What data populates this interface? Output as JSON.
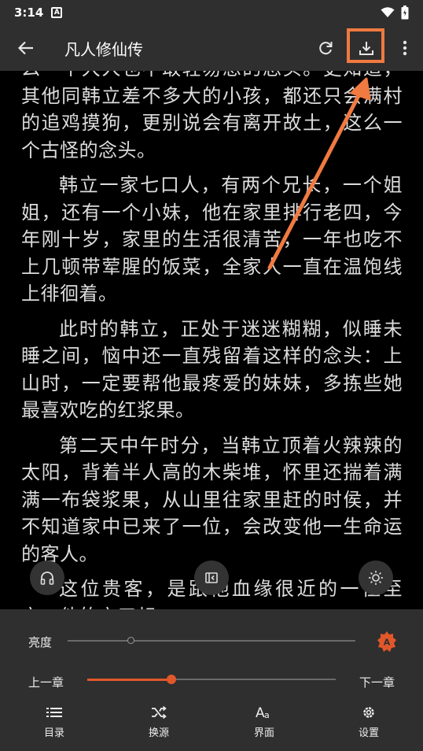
{
  "status_bar": {
    "time": "3:14",
    "notif_letter": "A"
  },
  "toolbar": {
    "title": "凡人修仙传"
  },
  "content": {
    "paragraphs": [
      "么一个大人也不敢轻易想的念头。更知道，其他同韩立差不多大的小孩，都还只会满村的追鸡摸狗，更别说会有离开故土，这么一个古怪的念头。",
      "韩立一家七口人，有两个兄长，一个姐姐，还有一个小妹，他在家里排行老四，今年刚十岁，家里的生活很清苦，一年也吃不上几顿带荤腥的饭菜，全家人一直在温饱线上徘徊着。",
      "此时的韩立，正处于迷迷糊糊，似睡未睡之间，恼中还一直残留着这样的念头：上山时，一定要帮他最疼爱的妹妹，多拣些她最喜欢吃的红浆果。",
      "第二天中午时分，当韩立顶着火辣辣的太阳，背着半人高的木柴堆，怀里还揣着满满一布袋浆果，从山里往家里赶的时侯，并不知道家中已来了一位，会改变他一生命运的客人。",
      "这位贵客，是跟他血缘很近的一位至亲，他的亲三叔。"
    ]
  },
  "brightness": {
    "label": "亮度",
    "level": 0.22,
    "auto_badge": "A"
  },
  "chapter": {
    "prev_label": "上一章",
    "next_label": "下一章",
    "progress": 0.34
  },
  "menu": {
    "items": [
      {
        "label": "目录",
        "icon": "list-icon"
      },
      {
        "label": "换源",
        "icon": "shuffle-icon"
      },
      {
        "label": "界面",
        "icon": "font-icon"
      },
      {
        "label": "设置",
        "icon": "gear-icon"
      }
    ]
  },
  "colors": {
    "accent": "#e2572a",
    "highlight": "#f07a40",
    "panel": "#2f2f2f"
  }
}
